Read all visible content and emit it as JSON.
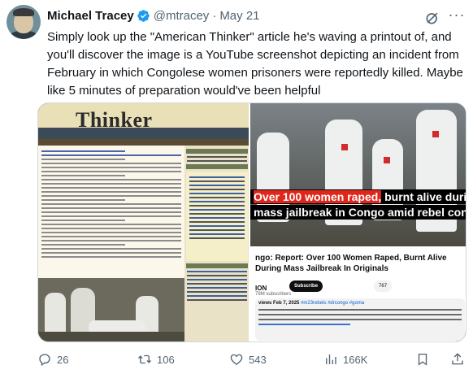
{
  "author": {
    "name": "Michael Tracey",
    "handle": "@mtracey",
    "separator": "·",
    "date": "May 21"
  },
  "tweet": {
    "text": "Simply look up the \"American Thinker\" article he's waving a printout of, and you'll discover the image is a YouTube screenshot depicting an incident from February in which Congolese women prisoners were reportedly killed. Maybe like 5 minutes of preparation would've been helpful"
  },
  "media": {
    "left": {
      "site_logo": "Thinker"
    },
    "right": {
      "caption_line1_highlight": "Over 100 women raped,",
      "caption_line1_rest": " burnt alive during",
      "caption_line2": "mass jailbreak in Congo amid rebel conflict",
      "video_title": "ngo: Report: Over 100 Women Raped, Burnt Alive During Mass Jailbreak In Originals",
      "channel_name": "ION",
      "subscribers": "79M subscribers",
      "subscribe_label": "Subscribe",
      "like_count": "767",
      "description_meta": "views Feb 7, 2025",
      "description_tags": "#m23rebels #drcongo #goma"
    }
  },
  "actions": {
    "replies": "26",
    "reposts": "106",
    "likes": "543",
    "views": "166K"
  },
  "icons": {
    "verified": "verified-badge-icon",
    "grok": "grok-icon",
    "more": "more-icon",
    "reply": "reply-icon",
    "repost": "repost-icon",
    "like": "heart-icon",
    "views": "views-icon",
    "bookmark": "bookmark-icon",
    "share": "share-icon"
  },
  "colors": {
    "verified": "#1d9bf0",
    "secondary_text": "#536471",
    "caption_highlight": "#e0261b"
  }
}
